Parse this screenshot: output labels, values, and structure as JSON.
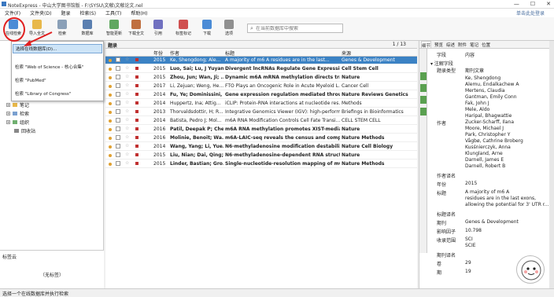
{
  "title": "NoteExpress - 中山大学图书馆版 - F:\\SYSU\\文献\\文献论文.nel",
  "menu": [
    "文件(F)",
    "文件夹(D)",
    "题录",
    "检索(S)",
    "工具(T)",
    "帮助(H)"
  ],
  "menu_right": "单击此处登录",
  "toolbar": [
    "在线检索",
    "导入全文",
    "检索",
    "数据库",
    "智能更新",
    "下载全文",
    "引用",
    "标签标记",
    "下载",
    "选项"
  ],
  "search_placeholder": "在当前数据库中搜索",
  "dropdown": [
    "选择在线数据库(D)...",
    "检索 \"Web of Science - 核心合集\"",
    "检索 \"PubMed\"",
    "检索 \"Library of Congress\""
  ],
  "tree": [
    "笔记",
    "检索",
    "组织",
    "回收站"
  ],
  "tagcloud": {
    "title": "标签云",
    "none": "（无标签）"
  },
  "main": {
    "title": "题录",
    "page": "1 / 13",
    "cols": [
      "年份",
      "作者",
      "标题",
      "来源"
    ]
  },
  "rows": [
    {
      "year": "2015",
      "author": "Ke, Shengdong; Ale...",
      "title": "A majority of m6       A residues are in the last...",
      "source": "Genes & Development",
      "sel": true,
      "bold": false,
      "dot": "#e0a030"
    },
    {
      "year": "2015",
      "author": "Luo, Sai; Lu, J Yuyan",
      "title": "Divergent lncRNAs Regulate Gene Expression a...",
      "source": "Cell Stem Cell",
      "sel": false,
      "bold": true,
      "dot": "#e0a030"
    },
    {
      "year": "2015",
      "author": "Zhou, Jun; Wan, Ji; ...",
      "title": "Dynamic m6A mRNA methylation directs transl...",
      "source": "Nature",
      "sel": false,
      "bold": true,
      "dot": "#e0a030"
    },
    {
      "year": "2017",
      "author": "Li, Zejuan; Weng, He...",
      "title": "FTO Plays an Oncogenic Role in Acute Myeloid L...",
      "source": "Cancer Cell",
      "sel": false,
      "bold": false,
      "dot": "#e0a030"
    },
    {
      "year": "2014",
      "author": "Fu, Ye; Dominissini, ...",
      "title": "Gene expression regulation mediated through ...",
      "source": "Nature Reviews Genetics",
      "sel": false,
      "bold": true,
      "dot": "#e0a030"
    },
    {
      "year": "2014",
      "author": "Huppertz, Ina; Attig...",
      "title": "iCLIP: Protein-RNA interactions at nucleotide res...",
      "source": "Methods",
      "sel": false,
      "bold": false,
      "dot": "#e0a030"
    },
    {
      "year": "2013",
      "author": "Thorvaldsdottir, H; R...",
      "title": "Integrative Genomics Viewer (IGV): high-perform...",
      "source": "Briefings in Bioinformatics",
      "sel": false,
      "bold": false,
      "dot": "#e0a030"
    },
    {
      "year": "2014",
      "author": "Batista, Pedro J; Mol...",
      "title": "m6A RNA Modification Controls Cell Fate Transi...",
      "source": "CELL STEM CELL",
      "sel": false,
      "bold": false,
      "dot": "#e0a030"
    },
    {
      "year": "2016",
      "author": "Patil, Deepak P; Che...",
      "title": "m6A RNA methylation promotes XIST-mediate...",
      "source": "Nature",
      "sel": false,
      "bold": true,
      "dot": "#e0a030"
    },
    {
      "year": "2016",
      "author": "Molinie, Benoit; Wa...",
      "title": "m6A-LAIC-seq reveals the census and complexi...",
      "source": "Nature Methods",
      "sel": false,
      "bold": true,
      "dot": "#e0a030"
    },
    {
      "year": "2014",
      "author": "Wang, Yang; Li, Yue...",
      "title": "N6-methyladenosine modification destabilizes ...",
      "source": "Nature Cell Biology",
      "sel": false,
      "bold": true,
      "dot": "#e0a030"
    },
    {
      "year": "2015",
      "author": "Liu, Nian; Dai, Qing; ...",
      "title": "N6-methyladenosine-dependent RNA structura...",
      "source": "Nature",
      "sel": false,
      "bold": true,
      "dot": "#e0a030"
    },
    {
      "year": "2015",
      "author": "Linder, Bastian; Gro...",
      "title": "Single-nucleotide-resolution mapping of m6A ...",
      "source": "Nature Methods",
      "sel": false,
      "bold": true,
      "dot": "#e0a030"
    }
  ],
  "right": {
    "tabs": [
      "细节",
      "预览",
      "综述",
      "附件",
      "笔记",
      "位置"
    ],
    "col1": "字段",
    "col2": "内容",
    "group": "注解字段",
    "fields": [
      {
        "k": "题录类型",
        "v": [
          "期刊文章"
        ]
      },
      {
        "k": "作者",
        "v": [
          "Ke, Shengdong",
          "Alemu, Endalkachew A",
          "Mertens, Claudia",
          "Gantman, Emily Conn",
          "Fak, John J",
          "Mele, Aldo",
          "Haripal, Bhagwattie",
          "Zucker-Scharff, Ilana",
          "Moore, Michael J",
          "Park, Christopher Y",
          "Vågbø, Cathrine Broberg",
          "Kusśnierczyk, Anna",
          "Klungland, Arne",
          "Darnell, James E",
          "Darnell, Robert B"
        ]
      },
      {
        "k": "作者译名",
        "v": [
          ""
        ]
      },
      {
        "k": "年份",
        "v": [
          "2015"
        ]
      },
      {
        "k": "标题",
        "v": [
          "A majority of m6        A",
          "residues are in the last exons,",
          "allowing the potential for 3' UTR r..."
        ]
      },
      {
        "k": "标题译名",
        "v": [
          ""
        ]
      },
      {
        "k": "期刊",
        "v": [
          "Genes & Development"
        ]
      },
      {
        "k": "影响因子",
        "v": [
          "10.798"
        ]
      },
      {
        "k": "收录范围",
        "v": [
          "SCI",
          "SCIE"
        ]
      },
      {
        "k": "期刊译名",
        "v": [
          ""
        ]
      },
      {
        "k": "卷",
        "v": [
          "29"
        ]
      },
      {
        "k": "期",
        "v": [
          "19"
        ]
      }
    ]
  },
  "status": "选择一个在线数据库并执行检索"
}
